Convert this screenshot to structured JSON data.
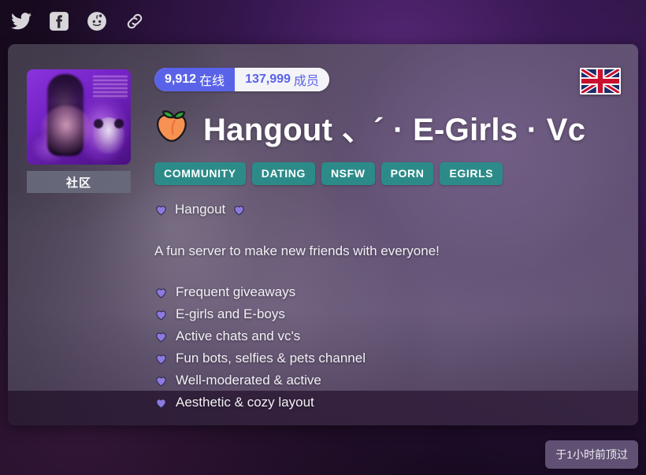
{
  "social_bar": {
    "items": [
      {
        "name": "twitter-icon",
        "label": "Twitter"
      },
      {
        "name": "facebook-icon",
        "label": "Facebook"
      },
      {
        "name": "reddit-icon",
        "label": "Reddit"
      },
      {
        "name": "link-icon",
        "label": "Copy link"
      }
    ]
  },
  "card": {
    "avatar": {
      "type_label": "社区"
    },
    "stats": {
      "online_value": "9,912",
      "online_unit": "在线",
      "members_value": "137,999",
      "members_unit": "成员"
    },
    "title": {
      "emoji": "peach-emoji",
      "text": "Hangout 、´ · E-Girls · Vc"
    },
    "tags": [
      "COMMUNITY",
      "DATING",
      "NSFW",
      "PORN",
      "EGIRLS"
    ],
    "description": {
      "heading": "Hangout",
      "tagline": "A fun server to make new friends with everyone!",
      "features": [
        "Frequent giveaways",
        "E-girls and E-boys",
        "Active chats and vc's",
        "Fun bots, selfies & pets channel",
        "Well-moderated & active",
        "Aesthetic & cozy layout"
      ]
    },
    "flag": {
      "name": "uk-flag-icon",
      "label": "United Kingdom"
    },
    "bumped_text": "于1小时前顶过"
  },
  "colors": {
    "accent_indigo": "#5a63e8",
    "tag_teal": "#2c8b89",
    "heart_purple": "#8b7be0",
    "card_bg_purple": "#6d5d7e"
  }
}
